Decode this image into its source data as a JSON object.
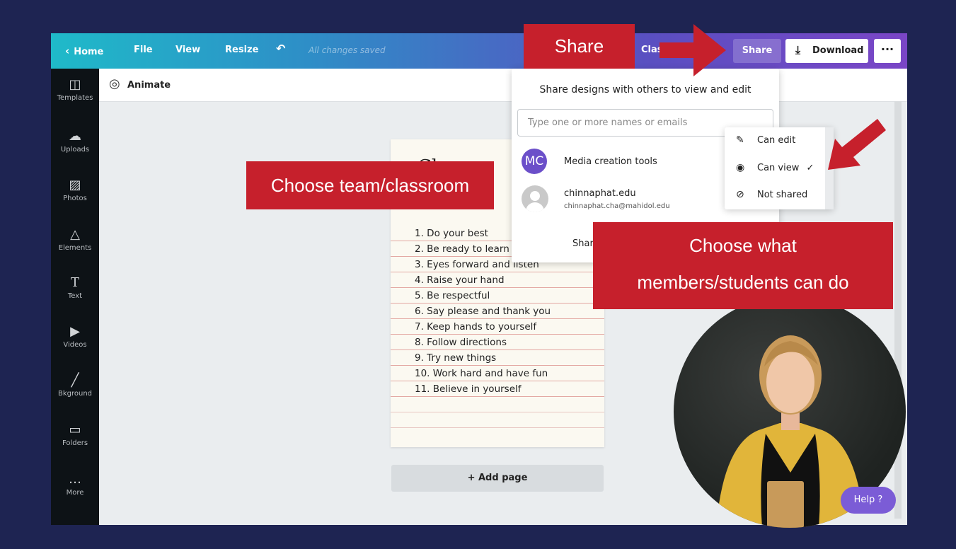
{
  "topbar": {
    "home_label": "Home",
    "file_label": "File",
    "view_label": "View",
    "resize_label": "Resize",
    "saved_status": "All changes saved",
    "title_partial": "Class",
    "share_label": "Share",
    "download_label": "Download",
    "more_label": "···"
  },
  "sidebar": {
    "items": [
      {
        "label": "Templates",
        "icon": "templates-icon"
      },
      {
        "label": "Uploads",
        "icon": "uploads-icon"
      },
      {
        "label": "Photos",
        "icon": "photos-icon"
      },
      {
        "label": "Elements",
        "icon": "elements-icon"
      },
      {
        "label": "Text",
        "icon": "text-icon"
      },
      {
        "label": "Videos",
        "icon": "videos-icon"
      },
      {
        "label": "Bkground",
        "icon": "background-icon"
      },
      {
        "label": "Folders",
        "icon": "folders-icon"
      },
      {
        "label": "More",
        "icon": "more-icon"
      }
    ]
  },
  "toolbar": {
    "animate_label": "Animate"
  },
  "canvas": {
    "heading_partial": "Cl     om",
    "rules": [
      "1. Do your best",
      "2. Be ready to learn",
      "3. Eyes forward and listen",
      "4. Raise your hand",
      "5. Be respectful",
      "6. Say please and thank you",
      "7. Keep hands to yourself",
      "8. Follow directions",
      "9. Try new things",
      "10. Work hard and have fun",
      "11. Believe in yourself"
    ],
    "add_page_label": "+ Add page"
  },
  "share_panel": {
    "title": "Share designs with others to view and edit",
    "input_placeholder": "Type one or more names or emails",
    "team": {
      "initials": "MC",
      "name": "Media creation tools"
    },
    "user": {
      "name": "chinnaphat.edu",
      "email": "chinnaphat.cha@mahidol.edu"
    },
    "share_button_partial": "Shar"
  },
  "permissions": {
    "can_edit": "Can edit",
    "can_view": "Can view",
    "can_view_check": "✓",
    "not_shared": "Not shared"
  },
  "help": {
    "label": "Help ?"
  },
  "callouts": {
    "share": "Share",
    "team": "Choose team/classroom",
    "members_line1": "Choose what",
    "members_line2": "members/students can do"
  },
  "colors": {
    "background": "#1e2452",
    "callout": "#c6202c",
    "accent_purple": "#7b5cd6",
    "team_avatar": "#6b4fc9"
  }
}
